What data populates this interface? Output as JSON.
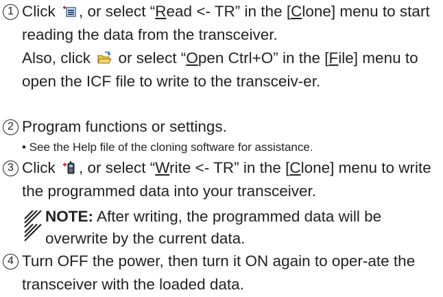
{
  "steps": [
    {
      "number": "1",
      "t1": "Click ",
      "icon1": "read-from-transceiver-icon",
      "t2": ", or select “",
      "u1": "R",
      "t3": "ead <- TR” in the [",
      "u2": "C",
      "t4": "lone] menu to start reading the data from the transceiver.",
      "t5": "Also, click ",
      "icon2": "open-folder-icon",
      "t6": " or select “",
      "u3": "O",
      "t7": "pen Ctrl+O” in the [",
      "u4": "F",
      "t8": "ile] menu to open the ICF file to write to the transceiv-er."
    },
    {
      "number": "2",
      "text": "Program functions or settings.",
      "bullet": "• See the Help file of the cloning software for assistance."
    },
    {
      "number": "3",
      "t1": "Click ",
      "icon1": "write-to-transceiver-icon",
      "t2": ", or select “",
      "u1": "W",
      "t3": "rite <- TR” in the [",
      "u2": "C",
      "t4": "lone] menu to write the programmed data into your transceiver."
    },
    {
      "number": "4",
      "text": "Turn OFF the power, then turn it ON again to oper-ate the transceiver with the loaded data."
    }
  ],
  "note": {
    "label": "NOTE:",
    "text": " After writing, the programmed data will be overwrite by the current data."
  }
}
